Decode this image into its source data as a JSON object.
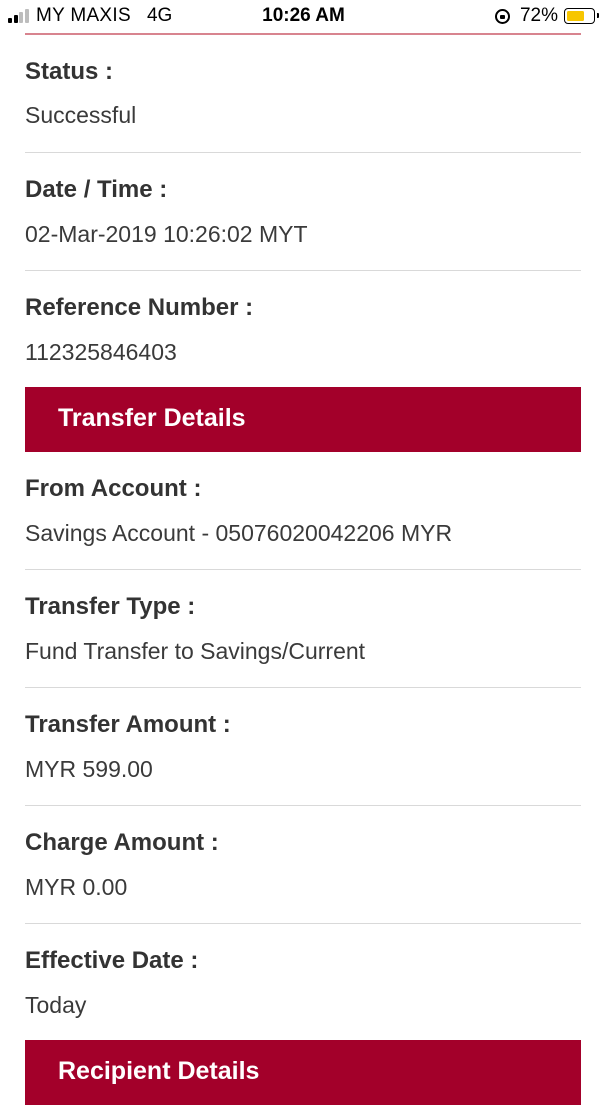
{
  "status_bar": {
    "carrier": "MY MAXIS",
    "network": "4G",
    "time": "10:26 AM",
    "battery_percent": "72%",
    "battery_level": 0.72,
    "signal_bars_filled": 2,
    "signal_bars_total": 4,
    "icons": [
      "signal-icon",
      "orientation-lock-icon",
      "battery-icon"
    ]
  },
  "receipt": {
    "status": {
      "label": "Status :",
      "value": "Successful"
    },
    "datetime": {
      "label": "Date / Time :",
      "value": "02-Mar-2019 10:26:02 MYT"
    },
    "reference": {
      "label": "Reference Number :",
      "value": "112325846403"
    }
  },
  "transfer_details": {
    "header": "Transfer Details",
    "from_account": {
      "label": "From Account :",
      "value": "Savings Account - 05076020042206 MYR"
    },
    "transfer_type": {
      "label": "Transfer Type :",
      "value": "Fund Transfer to Savings/Current"
    },
    "transfer_amount": {
      "label": "Transfer Amount :",
      "value": "MYR 599.00"
    },
    "charge_amount": {
      "label": "Charge Amount :",
      "value": "MYR 0.00"
    },
    "effective_date": {
      "label": "Effective Date :",
      "value": "Today"
    }
  },
  "recipient_details": {
    "header": "Recipient Details"
  },
  "colors": {
    "section_header_bg": "#a3002a",
    "section_header_text": "#ffffff",
    "battery_fill": "#f7c600"
  }
}
